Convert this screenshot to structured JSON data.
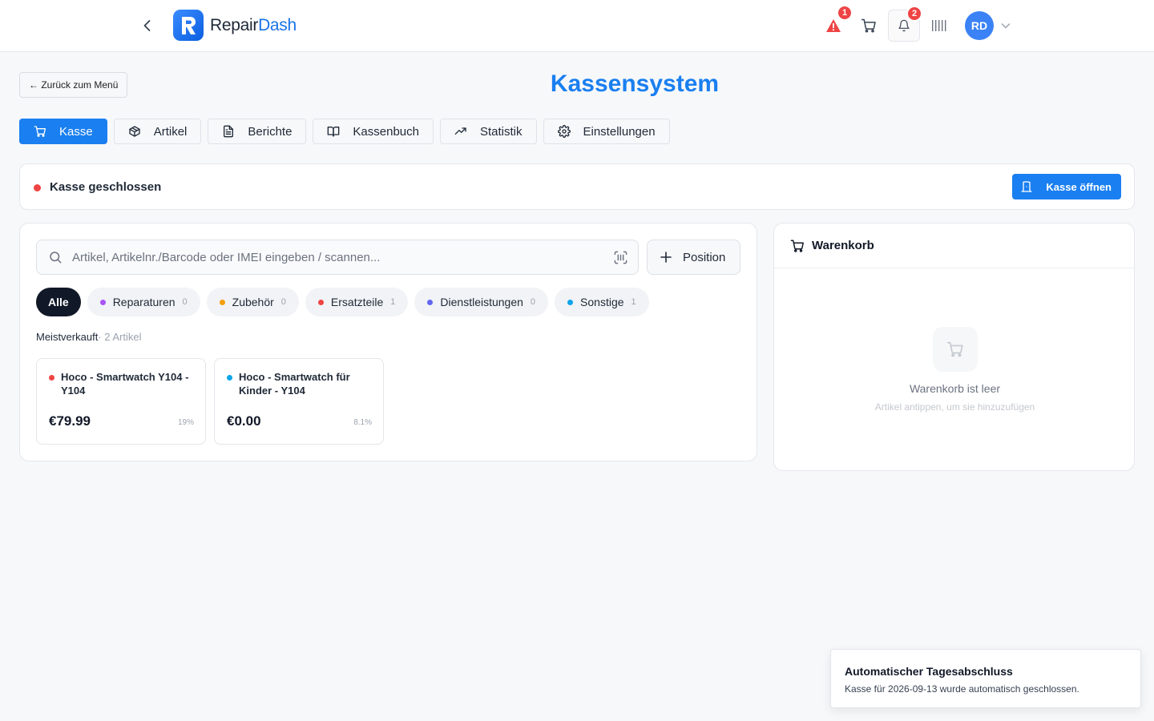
{
  "header": {
    "logo_main": "Repair",
    "logo_accent": "Dash",
    "alert_badge": "1",
    "notification_badge": "2",
    "avatar_initials": "RD"
  },
  "back_button_label": "← Zurück zum Menü",
  "page_title": "Kassensystem",
  "tabs": [
    {
      "label": "Kasse",
      "icon": "cart-icon",
      "active": true
    },
    {
      "label": "Artikel",
      "icon": "box-icon"
    },
    {
      "label": "Berichte",
      "icon": "document-icon"
    },
    {
      "label": "Kassenbuch",
      "icon": "book-icon"
    },
    {
      "label": "Statistik",
      "icon": "trend-icon"
    },
    {
      "label": "Einstellungen",
      "icon": "gear-icon"
    }
  ],
  "register_status": {
    "text": "Kasse geschlossen",
    "status_color": "#ef4444",
    "open_button_label": "Kasse öffnen"
  },
  "search": {
    "placeholder": "Artikel, Artikelnr./Barcode oder IMEI eingeben / scannen...",
    "value": ""
  },
  "add_position_label": "Position",
  "categories": [
    {
      "label": "Alle",
      "active": true
    },
    {
      "label": "Reparaturen",
      "count": "0",
      "color": "#a855f7"
    },
    {
      "label": "Zubehör",
      "count": "0",
      "color": "#f59e0b"
    },
    {
      "label": "Ersatzteile",
      "count": "1",
      "color": "#ef4444"
    },
    {
      "label": "Dienstleistungen",
      "count": "0",
      "color": "#6366f1"
    },
    {
      "label": "Sonstige",
      "count": "1",
      "color": "#0ea5e9"
    }
  ],
  "best_sellers": {
    "label": "Meistverkauft",
    "count": "· 2 Artikel"
  },
  "products": [
    {
      "name": "Hoco - Smartwatch Y104 - Y104",
      "price": "€79.99",
      "tax": "19%",
      "color": "#ef4444"
    },
    {
      "name": "Hoco - Smartwatch für Kinder - Y104",
      "price": "€0.00",
      "tax": "8.1%",
      "color": "#0ea5e9"
    }
  ],
  "cart": {
    "title": "Warenkorb",
    "empty_title": "Warenkorb ist leer",
    "empty_hint": "Artikel antippen, um sie hinzuzufügen"
  },
  "toast": {
    "title": "Automatischer Tagesabschluss",
    "message": "Kasse für 2026-09-13 wurde automatisch geschlossen."
  },
  "colors": {
    "accent": "#1a7ff0",
    "dark_chip": "#111827"
  }
}
